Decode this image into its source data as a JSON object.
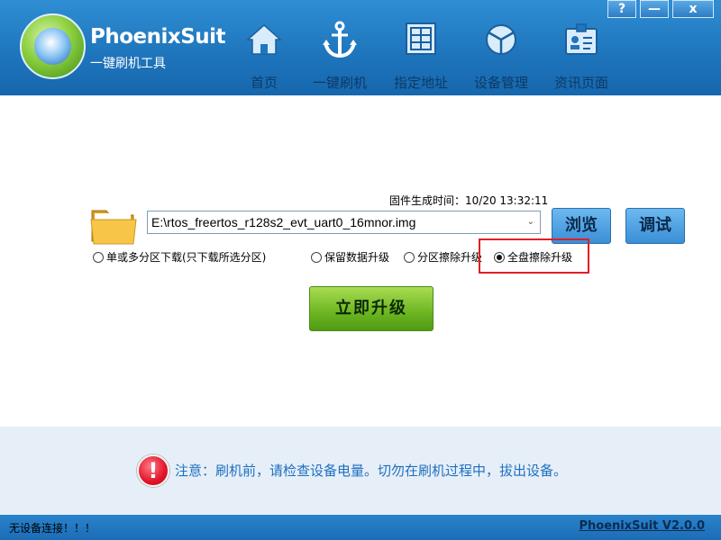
{
  "window": {
    "buttons": {
      "help": "?",
      "minimize": "—",
      "close": "x"
    }
  },
  "header": {
    "app_name": "PhoenixSuit",
    "subtitle": "一键刷机工具",
    "nav": [
      {
        "label": "首页",
        "icon": "home-icon"
      },
      {
        "label": "一键刷机",
        "icon": "anchor-icon"
      },
      {
        "label": "指定地址",
        "icon": "grid-icon"
      },
      {
        "label": "设备管理",
        "icon": "cube-icon"
      },
      {
        "label": "资讯页面",
        "icon": "id-card-icon"
      }
    ]
  },
  "firmware": {
    "time_label": "固件生成时间：",
    "time_value": "10/20 13:32:11",
    "path": "E:\\rtos_freertos_r128s2_evt_uart0_16mnor.img",
    "browse_label": "浏览",
    "debug_label": "调试"
  },
  "options": [
    {
      "label": "单或多分区下载(只下载所选分区)",
      "selected": false
    },
    {
      "label": "保留数据升级",
      "selected": false
    },
    {
      "label": "分区擦除升级",
      "selected": false
    },
    {
      "label": "全盘擦除升级",
      "selected": true
    }
  ],
  "actions": {
    "upgrade_label": "立即升级"
  },
  "notice": {
    "icon": "warning-icon",
    "text": "注意：刷机前，请检查设备电量。切勿在刷机过程中，拔出设备。"
  },
  "status": {
    "left": "无设备连接！！！",
    "right": "PhoenixSuit V2.0.0"
  },
  "colors": {
    "header_blue": "#1f76bd",
    "nav_label": "#0c3a66",
    "upgrade_green": "#6cb521",
    "highlight_red": "#e31e24",
    "notice_text": "#1e6fbf"
  }
}
